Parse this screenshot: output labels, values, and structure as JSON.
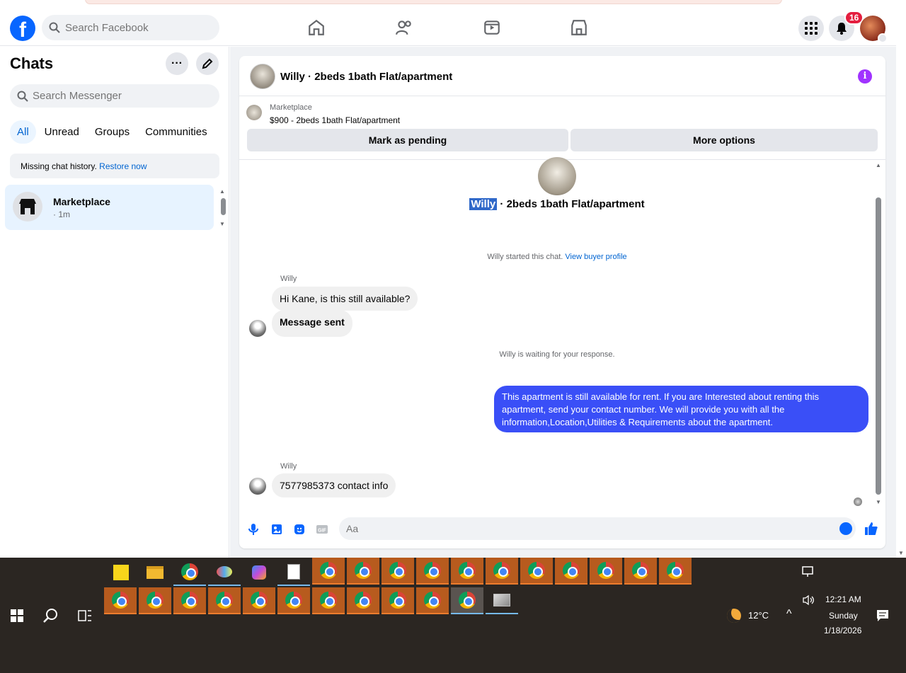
{
  "header": {
    "search_placeholder": "Search Facebook",
    "notification_count": "16"
  },
  "sidebar": {
    "title": "Chats",
    "search_placeholder": "Search Messenger",
    "filters": [
      "All",
      "Unread",
      "Groups",
      "Communities"
    ],
    "missing_text": "Missing chat history.",
    "restore_link": "Restore now",
    "chat_items": [
      {
        "name": "Marketplace",
        "time": "· 1m"
      }
    ]
  },
  "conversation": {
    "header_title": "Willy · 2beds 1bath Flat/apartment",
    "marketplace_label": "Marketplace",
    "listing": "$900 - 2beds 1bath Flat/apartment",
    "mark_pending": "Mark as pending",
    "more_options": "More options",
    "title_name": "Willy",
    "title_rest": "· 2beds 1bath Flat/apartment",
    "started_text": "Willy started this chat.",
    "view_profile": "View buyer profile",
    "waiting_text": "Willy is waiting for your response.",
    "messages": [
      {
        "sender": "Willy",
        "text": "Hi Kane, is this still available?"
      },
      {
        "text": "Message sent"
      },
      {
        "text": "This apartment is still available for rent. If you are Interested about renting this apartment, send your contact number. We will provide you with all the information,Location,Utilities & Requirements about the apartment."
      },
      {
        "sender": "Willy",
        "text": "7577985373 contact info"
      }
    ],
    "composer_placeholder": "Aa"
  },
  "taskbar": {
    "temperature": "12°C",
    "time": "12:21 AM",
    "day": "Sunday",
    "date": "1/18/2026"
  }
}
